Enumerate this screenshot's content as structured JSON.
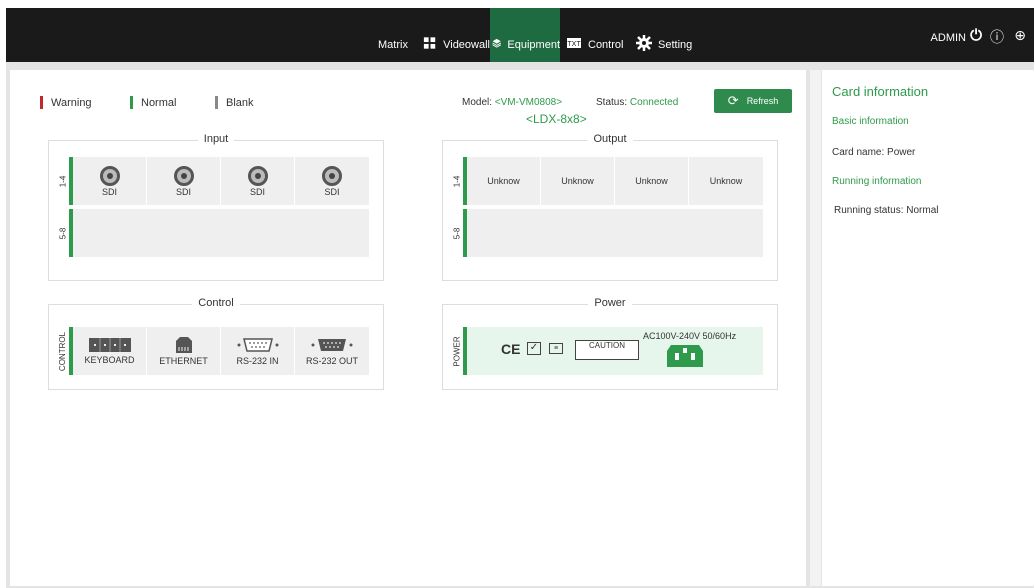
{
  "nav": {
    "items": [
      {
        "label": "Matrix",
        "icon": "matrix-icon"
      },
      {
        "label": "Videowall",
        "icon": "videowall-icon"
      },
      {
        "label": "Equipment",
        "icon": "equipment-icon",
        "active": true
      },
      {
        "label": "Control",
        "icon": "control-icon"
      },
      {
        "label": "Setting",
        "icon": "gear-icon"
      }
    ],
    "user": "ADMIN"
  },
  "legend": {
    "warning": "Warning",
    "normal": "Normal",
    "blank": "Blank"
  },
  "device": {
    "model_label": "Model:",
    "model_value": "<VM-VM0808>",
    "status_label": "Status:",
    "status_value": "Connected",
    "submodel": "<LDX-8x8>",
    "refresh_label": "Refresh"
  },
  "input": {
    "title": "Input",
    "rows": [
      {
        "label": "1-4",
        "ports": [
          "SDI",
          "SDI",
          "SDI",
          "SDI"
        ]
      },
      {
        "label": "5-8",
        "ports": []
      }
    ]
  },
  "output": {
    "title": "Output",
    "rows": [
      {
        "label": "1-4",
        "ports": [
          "Unknow",
          "Unknow",
          "Unknow",
          "Unknow"
        ]
      },
      {
        "label": "5-8",
        "ports": []
      }
    ]
  },
  "control": {
    "title": "Control",
    "row_label": "CONTROL",
    "ports": [
      "KEYBOARD",
      "ETHERNET",
      "RS-232 IN",
      "RS-232 OUT"
    ]
  },
  "power": {
    "title": "Power",
    "row_label": "POWER",
    "spec": "AC100V-240V 50/60Hz",
    "caution": "CAUTION"
  },
  "side": {
    "title": "Card information",
    "basic": "Basic information",
    "card_name": "Card name:  Power",
    "running": "Running information",
    "running_status": "Running status:  Normal"
  },
  "colors": {
    "accent": "#2e9a4b",
    "warning": "#c0282c",
    "blank": "#888888",
    "topbar": "#1a1a1a"
  }
}
